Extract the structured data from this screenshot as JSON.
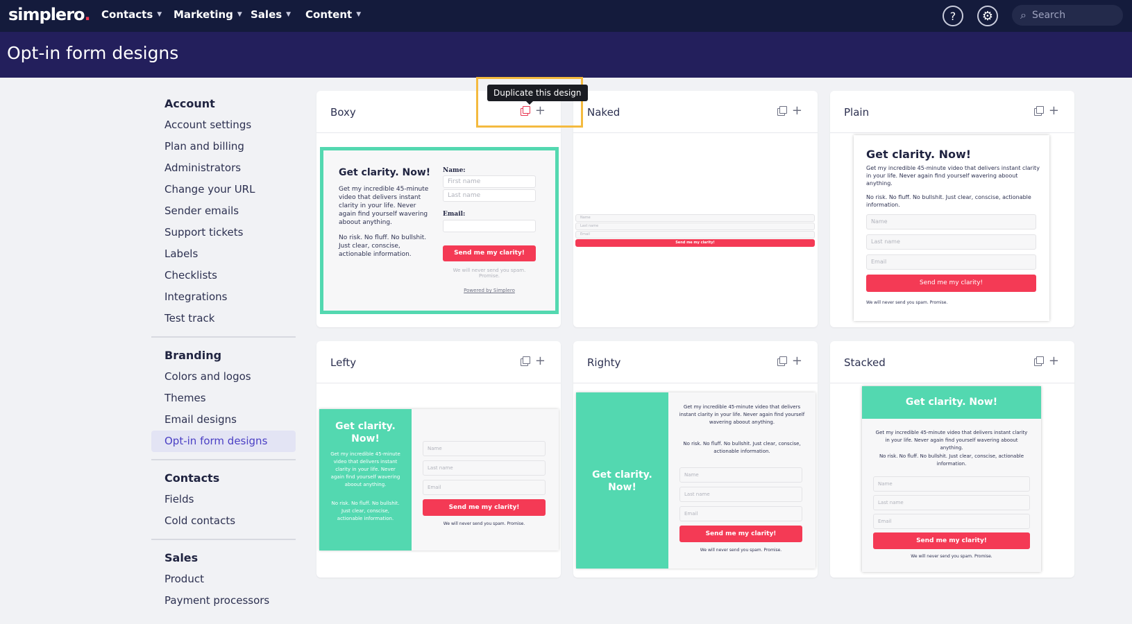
{
  "nav": {
    "logo": "simplero",
    "logo_dot": ".",
    "items": [
      {
        "label": "Contacts"
      },
      {
        "label": "Marketing"
      },
      {
        "label": "Sales"
      },
      {
        "label": "Content"
      }
    ],
    "help_glyph": "?",
    "settings_glyph": "⚙",
    "search_placeholder": "Search",
    "search_glyph": "⌕"
  },
  "page": {
    "title": "Opt-in form designs"
  },
  "sidebar": {
    "groups": [
      {
        "heading": "Account",
        "items": [
          "Account settings",
          "Plan and billing",
          "Administrators",
          "Change your URL",
          "Sender emails",
          "Support tickets",
          "Labels",
          "Checklists",
          "Integrations",
          "Test track"
        ]
      },
      {
        "heading": "Branding",
        "items": [
          "Colors and logos",
          "Themes",
          "Email designs",
          "Opt-in form designs"
        ]
      },
      {
        "heading": "Contacts",
        "items": [
          "Fields",
          "Cold contacts"
        ]
      },
      {
        "heading": "Sales",
        "items": [
          "Product",
          "Payment processors"
        ]
      }
    ],
    "active_item": "Opt-in form designs"
  },
  "tooltip": "Duplicate this design",
  "cards": [
    "Boxy",
    "Naked",
    "Plain",
    "Lefty",
    "Righty",
    "Stacked"
  ],
  "form": {
    "headline": "Get clarity. Now!",
    "headline_split": [
      "Get clarity.",
      "Now!"
    ],
    "body": "Get my incredible 45-minute video that delivers instant clarity in your life. Never again find yourself wavering aboout anything.",
    "body2": "No risk. No fluff. No bullshit. Just clear, conscise, actionable information.",
    "name_label": "Name:",
    "email_label": "Email:",
    "first_name": "First name",
    "last_name": "Last name",
    "name": "Name",
    "last_name_lc": "Last name",
    "email": "Email",
    "button": "Send me my clarity!",
    "spam": "We will never send you spam. Promise.",
    "powered": "Powered by Simplero"
  },
  "colors": {
    "brand_red": "#f43a55",
    "form_green": "#53d8b0",
    "nav_bg": "#141b3c",
    "header_bg": "#231f5c",
    "highlight": "#f4ba3f"
  }
}
